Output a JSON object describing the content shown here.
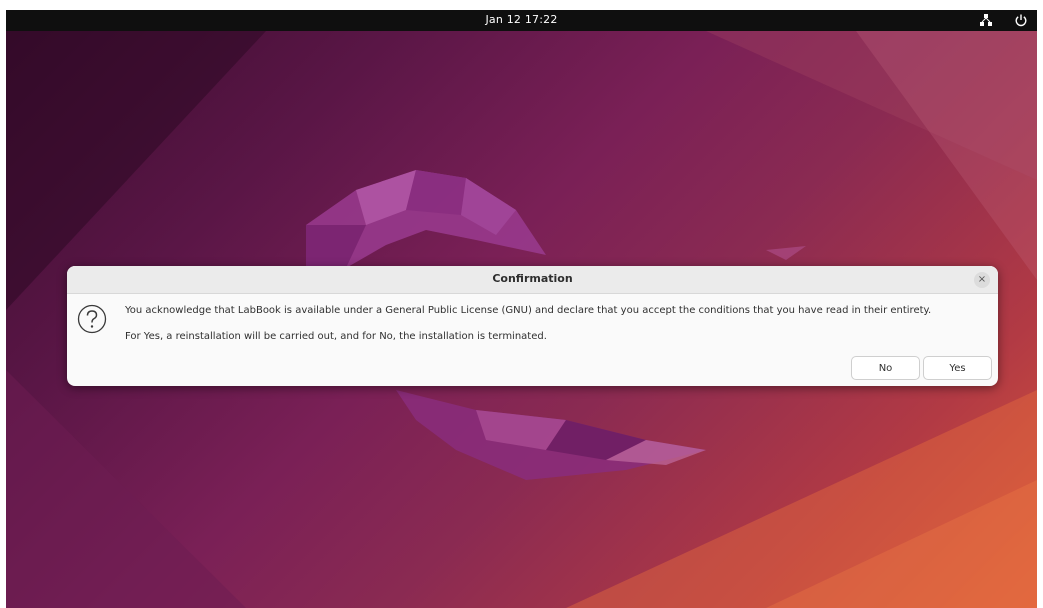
{
  "topbar": {
    "clock": "Jan 12  17:22",
    "network_icon": "network-icon",
    "power_icon": "power-icon"
  },
  "dialog": {
    "title": "Confirmation",
    "close_label": "×",
    "icon": "question-icon",
    "message_line1": "You acknowledge that LabBook is available under a General Public License (GNU) and declare that you accept the conditions that you have read in their entirety.",
    "message_line2": "For Yes, a reinstallation will be carried out, and for No, the installation is terminated.",
    "no_label": "No",
    "yes_label": "Yes"
  },
  "colors": {
    "topbar": "#0f0f0f",
    "dialog_bg": "#fafafa",
    "titlebar_bg": "#ebebeb",
    "wallpaper_dark": "#3a0c2e",
    "wallpaper_mid": "#7a2056",
    "wallpaper_orange": "#d8583a"
  }
}
